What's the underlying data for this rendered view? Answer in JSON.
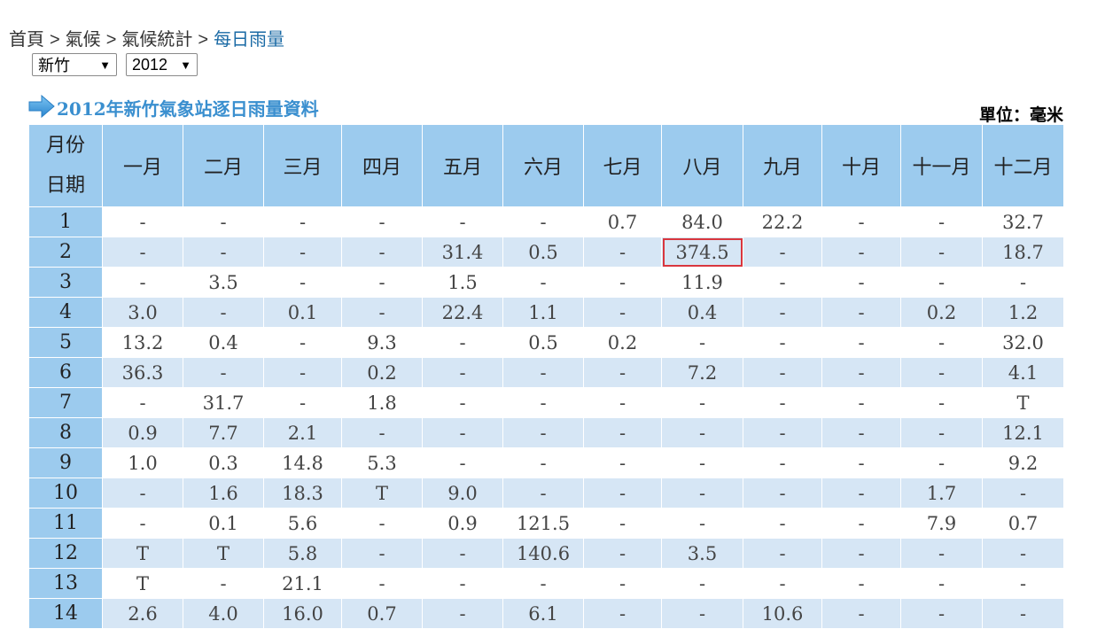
{
  "breadcrumb": {
    "items": [
      "首頁",
      "氣候",
      "氣候統計"
    ],
    "current": "每日雨量",
    "separator": ">"
  },
  "filters": {
    "station": "新竹",
    "year": "2012"
  },
  "report": {
    "title": "2012年新竹氣象站逐日雨量資料",
    "unit": "單位：毫米"
  },
  "table": {
    "corner_top": "月份",
    "corner_bottom": "日期",
    "months": [
      "一月",
      "二月",
      "三月",
      "四月",
      "五月",
      "六月",
      "七月",
      "八月",
      "九月",
      "十月",
      "十一月",
      "十二月"
    ],
    "rows": [
      {
        "day": "1",
        "values": [
          "-",
          "-",
          "-",
          "-",
          "-",
          "-",
          "0.7",
          "84.0",
          "22.2",
          "-",
          "-",
          "32.7"
        ]
      },
      {
        "day": "2",
        "values": [
          "-",
          "-",
          "-",
          "-",
          "31.4",
          "0.5",
          "-",
          "374.5",
          "-",
          "-",
          "-",
          "18.7"
        ]
      },
      {
        "day": "3",
        "values": [
          "-",
          "3.5",
          "-",
          "-",
          "1.5",
          "-",
          "-",
          "11.9",
          "-",
          "-",
          "-",
          "-"
        ]
      },
      {
        "day": "4",
        "values": [
          "3.0",
          "-",
          "0.1",
          "-",
          "22.4",
          "1.1",
          "-",
          "0.4",
          "-",
          "-",
          "0.2",
          "1.2"
        ]
      },
      {
        "day": "5",
        "values": [
          "13.2",
          "0.4",
          "-",
          "9.3",
          "-",
          "0.5",
          "0.2",
          "-",
          "-",
          "-",
          "-",
          "32.0"
        ]
      },
      {
        "day": "6",
        "values": [
          "36.3",
          "-",
          "-",
          "0.2",
          "-",
          "-",
          "-",
          "7.2",
          "-",
          "-",
          "-",
          "4.1"
        ]
      },
      {
        "day": "7",
        "values": [
          "-",
          "31.7",
          "-",
          "1.8",
          "-",
          "-",
          "-",
          "-",
          "-",
          "-",
          "-",
          "T"
        ]
      },
      {
        "day": "8",
        "values": [
          "0.9",
          "7.7",
          "2.1",
          "-",
          "-",
          "-",
          "-",
          "-",
          "-",
          "-",
          "-",
          "12.1"
        ]
      },
      {
        "day": "9",
        "values": [
          "1.0",
          "0.3",
          "14.8",
          "5.3",
          "-",
          "-",
          "-",
          "-",
          "-",
          "-",
          "-",
          "9.2"
        ]
      },
      {
        "day": "10",
        "values": [
          "-",
          "1.6",
          "18.3",
          "T",
          "9.0",
          "-",
          "-",
          "-",
          "-",
          "-",
          "1.7",
          "-"
        ]
      },
      {
        "day": "11",
        "values": [
          "-",
          "0.1",
          "5.6",
          "-",
          "0.9",
          "121.5",
          "-",
          "-",
          "-",
          "-",
          "7.9",
          "0.7"
        ]
      },
      {
        "day": "12",
        "values": [
          "T",
          "T",
          "5.8",
          "-",
          "-",
          "140.6",
          "-",
          "3.5",
          "-",
          "-",
          "-",
          "-"
        ]
      },
      {
        "day": "13",
        "values": [
          "T",
          "-",
          "21.1",
          "-",
          "-",
          "-",
          "-",
          "-",
          "-",
          "-",
          "-",
          "-"
        ]
      },
      {
        "day": "14",
        "values": [
          "2.6",
          "4.0",
          "16.0",
          "0.7",
          "-",
          "6.1",
          "-",
          "-",
          "10.6",
          "-",
          "-",
          "-"
        ]
      }
    ],
    "highlighted_cell": {
      "day": "2",
      "month": "八月"
    }
  },
  "colors": {
    "header_bg": "#9ccbee",
    "stripe_bg": "#d6e6f5",
    "title_color": "#3a8fcf",
    "highlight_border": "#d9363e"
  },
  "icons": {
    "title_arrow": "arrow-right-icon",
    "select_caret": "caret-down-icon"
  }
}
